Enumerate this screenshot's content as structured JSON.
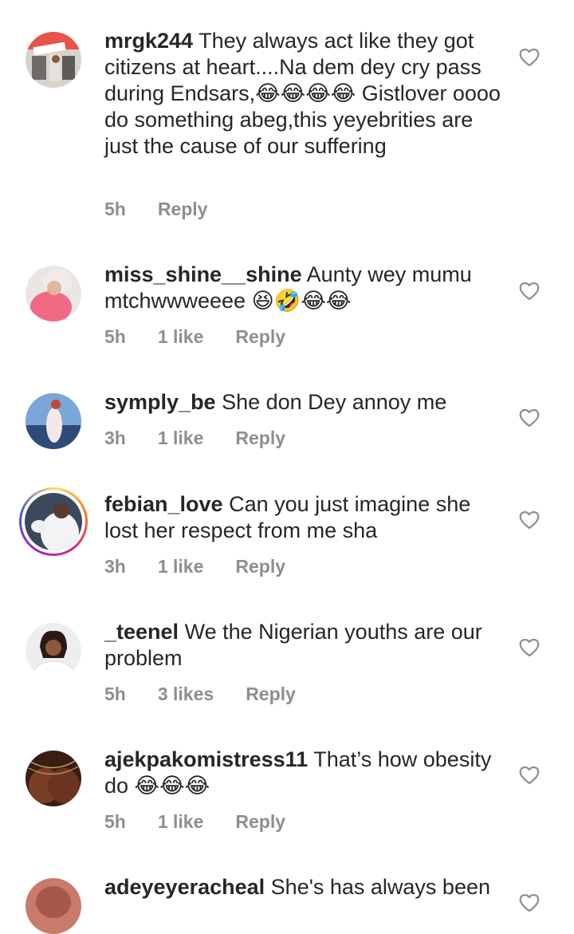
{
  "comments": [
    {
      "username": "mrgk244",
      "text": "They always act like they got citizens at heart....Na dem dey cry pass during Endsars,😂😂😂😂 Gistlover oooo do something abeg,this yeyebrities are just the cause of our suffering",
      "time": "5h",
      "likes": "",
      "reply": "Reply"
    },
    {
      "username": "miss_shine__shine",
      "text": "Aunty wey mumu mtchwwweeee 😆🤣😂😂",
      "time": "5h",
      "likes": "1 like",
      "reply": "Reply"
    },
    {
      "username": "symply_be",
      "text": "She don Dey annoy me",
      "time": "3h",
      "likes": "1 like",
      "reply": "Reply"
    },
    {
      "username": "febian_love",
      "text": "Can you just imagine she lost her respect from me sha",
      "time": "3h",
      "likes": "1 like",
      "reply": "Reply"
    },
    {
      "username": "_teenel",
      "text": "We the Nigerian youths are our problem",
      "time": "5h",
      "likes": "3 likes",
      "reply": "Reply"
    },
    {
      "username": "ajekpakomistress11",
      "text": "That’s how obesity do 😂😂😂",
      "time": "5h",
      "likes": "1 like",
      "reply": "Reply"
    },
    {
      "username": "adeyeyeracheal",
      "text": "She's has always been",
      "time": "",
      "likes": "",
      "reply": ""
    }
  ],
  "icons": {
    "like": "heart-outline-icon"
  },
  "colors": {
    "text": "#262626",
    "meta": "#8e8e8e",
    "heart": "#8e8e8e"
  }
}
